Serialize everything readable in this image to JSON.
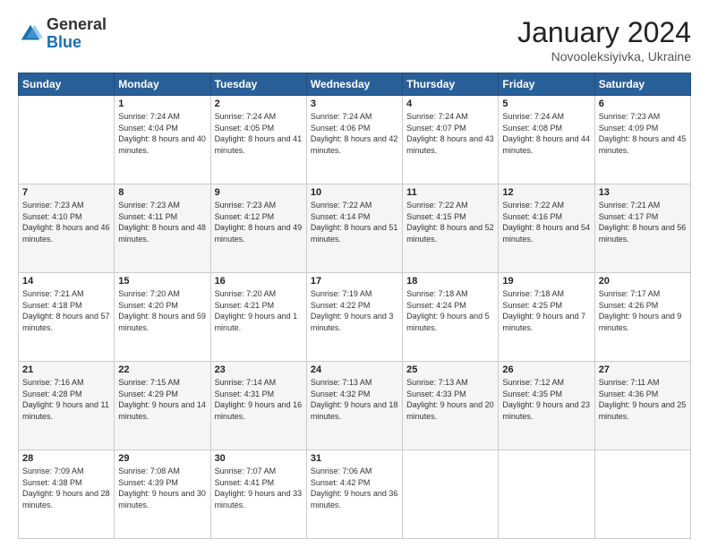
{
  "logo": {
    "general": "General",
    "blue": "Blue"
  },
  "header": {
    "title": "January 2024",
    "subtitle": "Novooleksiyivka, Ukraine"
  },
  "days_of_week": [
    "Sunday",
    "Monday",
    "Tuesday",
    "Wednesday",
    "Thursday",
    "Friday",
    "Saturday"
  ],
  "weeks": [
    [
      {
        "day": "",
        "sunrise": "",
        "sunset": "",
        "daylight": ""
      },
      {
        "day": "1",
        "sunrise": "Sunrise: 7:24 AM",
        "sunset": "Sunset: 4:04 PM",
        "daylight": "Daylight: 8 hours and 40 minutes."
      },
      {
        "day": "2",
        "sunrise": "Sunrise: 7:24 AM",
        "sunset": "Sunset: 4:05 PM",
        "daylight": "Daylight: 8 hours and 41 minutes."
      },
      {
        "day": "3",
        "sunrise": "Sunrise: 7:24 AM",
        "sunset": "Sunset: 4:06 PM",
        "daylight": "Daylight: 8 hours and 42 minutes."
      },
      {
        "day": "4",
        "sunrise": "Sunrise: 7:24 AM",
        "sunset": "Sunset: 4:07 PM",
        "daylight": "Daylight: 8 hours and 43 minutes."
      },
      {
        "day": "5",
        "sunrise": "Sunrise: 7:24 AM",
        "sunset": "Sunset: 4:08 PM",
        "daylight": "Daylight: 8 hours and 44 minutes."
      },
      {
        "day": "6",
        "sunrise": "Sunrise: 7:23 AM",
        "sunset": "Sunset: 4:09 PM",
        "daylight": "Daylight: 8 hours and 45 minutes."
      }
    ],
    [
      {
        "day": "7",
        "sunrise": "Sunrise: 7:23 AM",
        "sunset": "Sunset: 4:10 PM",
        "daylight": "Daylight: 8 hours and 46 minutes."
      },
      {
        "day": "8",
        "sunrise": "Sunrise: 7:23 AM",
        "sunset": "Sunset: 4:11 PM",
        "daylight": "Daylight: 8 hours and 48 minutes."
      },
      {
        "day": "9",
        "sunrise": "Sunrise: 7:23 AM",
        "sunset": "Sunset: 4:12 PM",
        "daylight": "Daylight: 8 hours and 49 minutes."
      },
      {
        "day": "10",
        "sunrise": "Sunrise: 7:22 AM",
        "sunset": "Sunset: 4:14 PM",
        "daylight": "Daylight: 8 hours and 51 minutes."
      },
      {
        "day": "11",
        "sunrise": "Sunrise: 7:22 AM",
        "sunset": "Sunset: 4:15 PM",
        "daylight": "Daylight: 8 hours and 52 minutes."
      },
      {
        "day": "12",
        "sunrise": "Sunrise: 7:22 AM",
        "sunset": "Sunset: 4:16 PM",
        "daylight": "Daylight: 8 hours and 54 minutes."
      },
      {
        "day": "13",
        "sunrise": "Sunrise: 7:21 AM",
        "sunset": "Sunset: 4:17 PM",
        "daylight": "Daylight: 8 hours and 56 minutes."
      }
    ],
    [
      {
        "day": "14",
        "sunrise": "Sunrise: 7:21 AM",
        "sunset": "Sunset: 4:18 PM",
        "daylight": "Daylight: 8 hours and 57 minutes."
      },
      {
        "day": "15",
        "sunrise": "Sunrise: 7:20 AM",
        "sunset": "Sunset: 4:20 PM",
        "daylight": "Daylight: 8 hours and 59 minutes."
      },
      {
        "day": "16",
        "sunrise": "Sunrise: 7:20 AM",
        "sunset": "Sunset: 4:21 PM",
        "daylight": "Daylight: 9 hours and 1 minute."
      },
      {
        "day": "17",
        "sunrise": "Sunrise: 7:19 AM",
        "sunset": "Sunset: 4:22 PM",
        "daylight": "Daylight: 9 hours and 3 minutes."
      },
      {
        "day": "18",
        "sunrise": "Sunrise: 7:18 AM",
        "sunset": "Sunset: 4:24 PM",
        "daylight": "Daylight: 9 hours and 5 minutes."
      },
      {
        "day": "19",
        "sunrise": "Sunrise: 7:18 AM",
        "sunset": "Sunset: 4:25 PM",
        "daylight": "Daylight: 9 hours and 7 minutes."
      },
      {
        "day": "20",
        "sunrise": "Sunrise: 7:17 AM",
        "sunset": "Sunset: 4:26 PM",
        "daylight": "Daylight: 9 hours and 9 minutes."
      }
    ],
    [
      {
        "day": "21",
        "sunrise": "Sunrise: 7:16 AM",
        "sunset": "Sunset: 4:28 PM",
        "daylight": "Daylight: 9 hours and 11 minutes."
      },
      {
        "day": "22",
        "sunrise": "Sunrise: 7:15 AM",
        "sunset": "Sunset: 4:29 PM",
        "daylight": "Daylight: 9 hours and 14 minutes."
      },
      {
        "day": "23",
        "sunrise": "Sunrise: 7:14 AM",
        "sunset": "Sunset: 4:31 PM",
        "daylight": "Daylight: 9 hours and 16 minutes."
      },
      {
        "day": "24",
        "sunrise": "Sunrise: 7:13 AM",
        "sunset": "Sunset: 4:32 PM",
        "daylight": "Daylight: 9 hours and 18 minutes."
      },
      {
        "day": "25",
        "sunrise": "Sunrise: 7:13 AM",
        "sunset": "Sunset: 4:33 PM",
        "daylight": "Daylight: 9 hours and 20 minutes."
      },
      {
        "day": "26",
        "sunrise": "Sunrise: 7:12 AM",
        "sunset": "Sunset: 4:35 PM",
        "daylight": "Daylight: 9 hours and 23 minutes."
      },
      {
        "day": "27",
        "sunrise": "Sunrise: 7:11 AM",
        "sunset": "Sunset: 4:36 PM",
        "daylight": "Daylight: 9 hours and 25 minutes."
      }
    ],
    [
      {
        "day": "28",
        "sunrise": "Sunrise: 7:09 AM",
        "sunset": "Sunset: 4:38 PM",
        "daylight": "Daylight: 9 hours and 28 minutes."
      },
      {
        "day": "29",
        "sunrise": "Sunrise: 7:08 AM",
        "sunset": "Sunset: 4:39 PM",
        "daylight": "Daylight: 9 hours and 30 minutes."
      },
      {
        "day": "30",
        "sunrise": "Sunrise: 7:07 AM",
        "sunset": "Sunset: 4:41 PM",
        "daylight": "Daylight: 9 hours and 33 minutes."
      },
      {
        "day": "31",
        "sunrise": "Sunrise: 7:06 AM",
        "sunset": "Sunset: 4:42 PM",
        "daylight": "Daylight: 9 hours and 36 minutes."
      },
      {
        "day": "",
        "sunrise": "",
        "sunset": "",
        "daylight": ""
      },
      {
        "day": "",
        "sunrise": "",
        "sunset": "",
        "daylight": ""
      },
      {
        "day": "",
        "sunrise": "",
        "sunset": "",
        "daylight": ""
      }
    ]
  ]
}
